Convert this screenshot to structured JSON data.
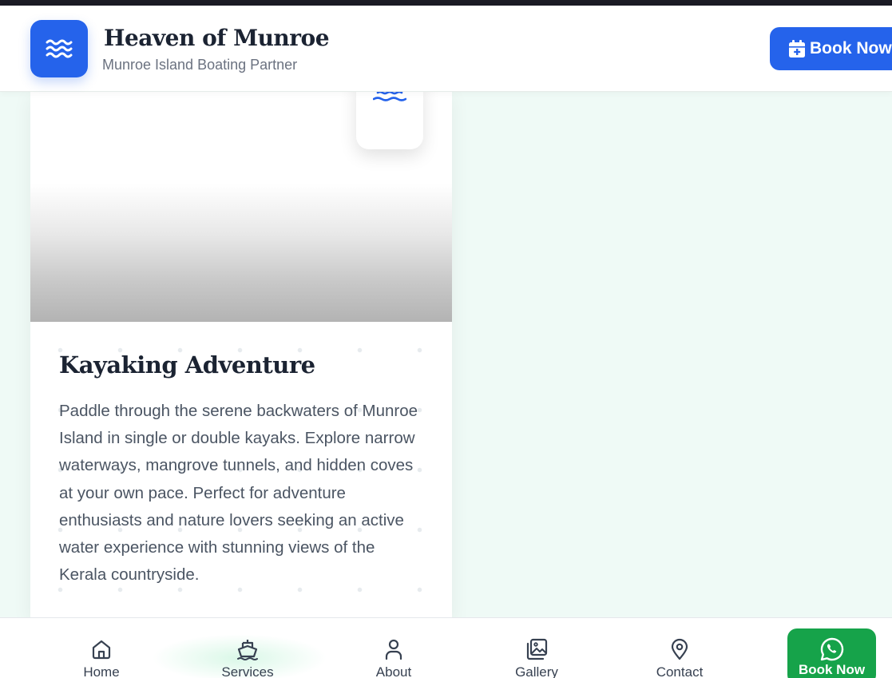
{
  "header": {
    "title": "Heaven of Munroe",
    "subtitle": "Munroe Island Boating Partner",
    "book_button": "Book Now",
    "logo_icon": "waves-icon",
    "accent_color": "#2563eb"
  },
  "card": {
    "title": "Kayaking Adventure",
    "description": "Paddle through the serene backwaters of Munroe Island in single or double kayaks. Explore narrow waterways, mangrove tunnels, and hidden coves at your own pace. Perfect for adventure enthusiasts and nature lovers seeking an active water experience with stunning views of the Kerala countryside.",
    "badge_icon": "water-icon"
  },
  "bottom_nav": {
    "items": [
      {
        "label": "Home",
        "icon": "home-icon"
      },
      {
        "label": "Services",
        "icon": "ship-icon"
      },
      {
        "label": "About",
        "icon": "user-icon"
      },
      {
        "label": "Gallery",
        "icon": "images-icon"
      },
      {
        "label": "Contact",
        "icon": "map-pin-icon"
      }
    ],
    "whatsapp_button": {
      "label": "Book Now",
      "icon": "whatsapp-icon",
      "color": "#16a34a"
    }
  }
}
